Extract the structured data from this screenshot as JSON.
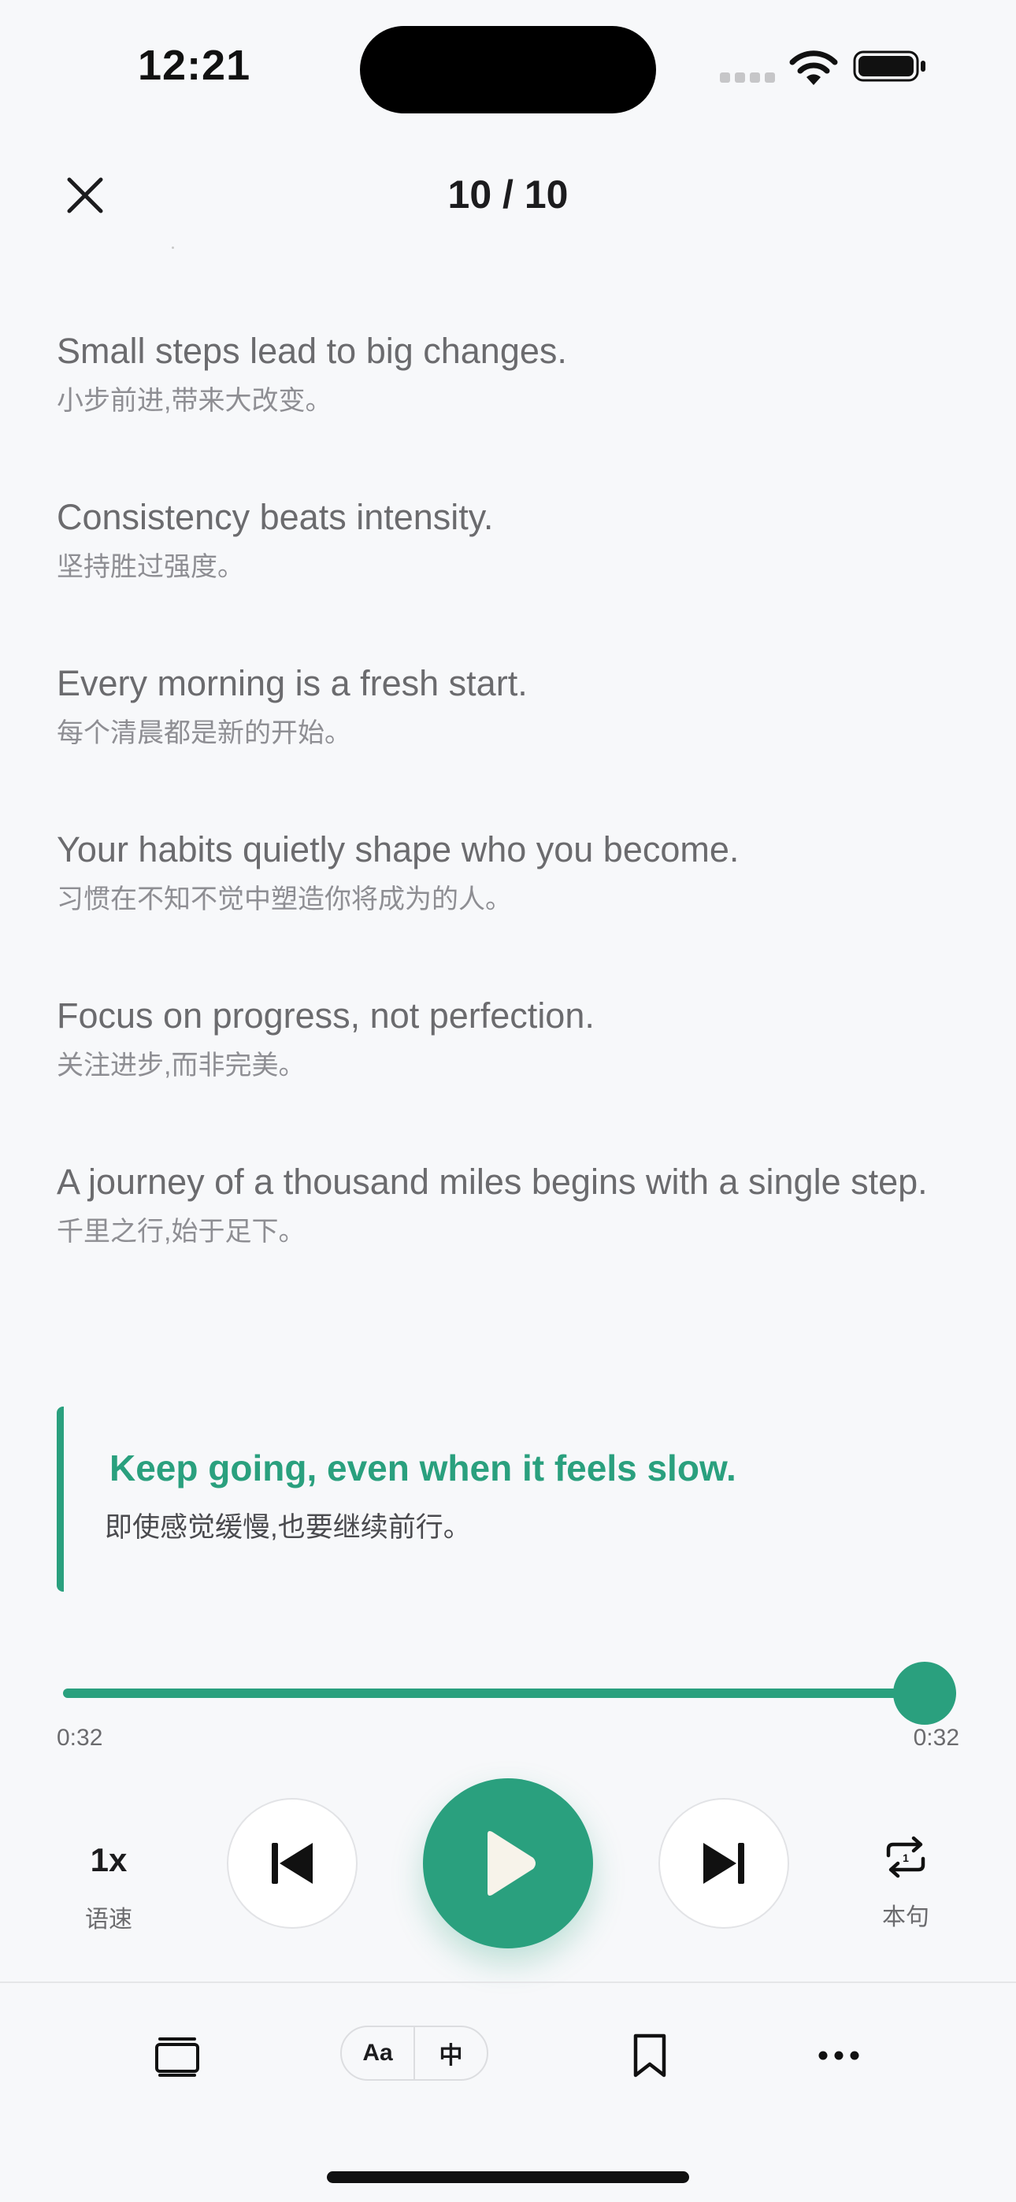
{
  "status_bar": {
    "time": "12:21"
  },
  "header": {
    "counter": "10 / 10"
  },
  "sentences": [
    {
      "en": "Small steps lead to big changes.",
      "zh": "小步前进,带来大改变。"
    },
    {
      "en": "Consistency beats intensity.",
      "zh": "坚持胜过强度。"
    },
    {
      "en": "Every morning is a fresh start.",
      "zh": "每个清晨都是新的开始。"
    },
    {
      "en": "Your habits quietly shape who you become.",
      "zh": "习惯在不知不觉中塑造你将成为的人。"
    },
    {
      "en": "Focus on progress, not perfection.",
      "zh": "关注进步,而非完美。"
    },
    {
      "en": "A journey of a thousand miles begins with a single step.",
      "zh": "千里之行,始于足下。"
    }
  ],
  "active_sentence": {
    "en": "Keep going, even when it feels slow.",
    "zh": "即使感觉缓慢,也要继续前行。"
  },
  "player": {
    "elapsed": "0:32",
    "duration": "0:32",
    "progress": 1.0,
    "speed_value": "1x",
    "speed_label": "语速",
    "repeat_label": "本句"
  },
  "toolbar": {
    "font_toggle": "Aa",
    "lang_toggle": "中"
  },
  "colors": {
    "accent": "#2aa07e",
    "background": "#f7f8fa"
  }
}
